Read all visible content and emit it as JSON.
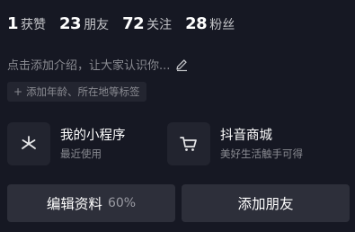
{
  "stats": [
    {
      "value": "1",
      "label": "获赞"
    },
    {
      "value": "23",
      "label": "朋友"
    },
    {
      "value": "72",
      "label": "关注"
    },
    {
      "value": "28",
      "label": "粉丝"
    }
  ],
  "intro": {
    "prompt": "点击添加介绍，让大家认识你...",
    "icon": "pencil-icon"
  },
  "tag_chip": {
    "plus": "+",
    "label": "添加年龄、所在地等标签"
  },
  "services": [
    {
      "title": "我的小程序",
      "subtitle": "最近使用",
      "icon": "mini-program-icon"
    },
    {
      "title": "抖音商城",
      "subtitle": "美好生活触手可得",
      "icon": "shopping-cart-icon"
    }
  ],
  "buttons": {
    "edit_label": "编辑资料",
    "edit_percent": "60%",
    "add_friend_label": "添加朋友"
  },
  "colors": {
    "background": "#161823",
    "card": "#22242f",
    "button": "#2d2f3a",
    "secondary_text": "#8a8b92"
  }
}
